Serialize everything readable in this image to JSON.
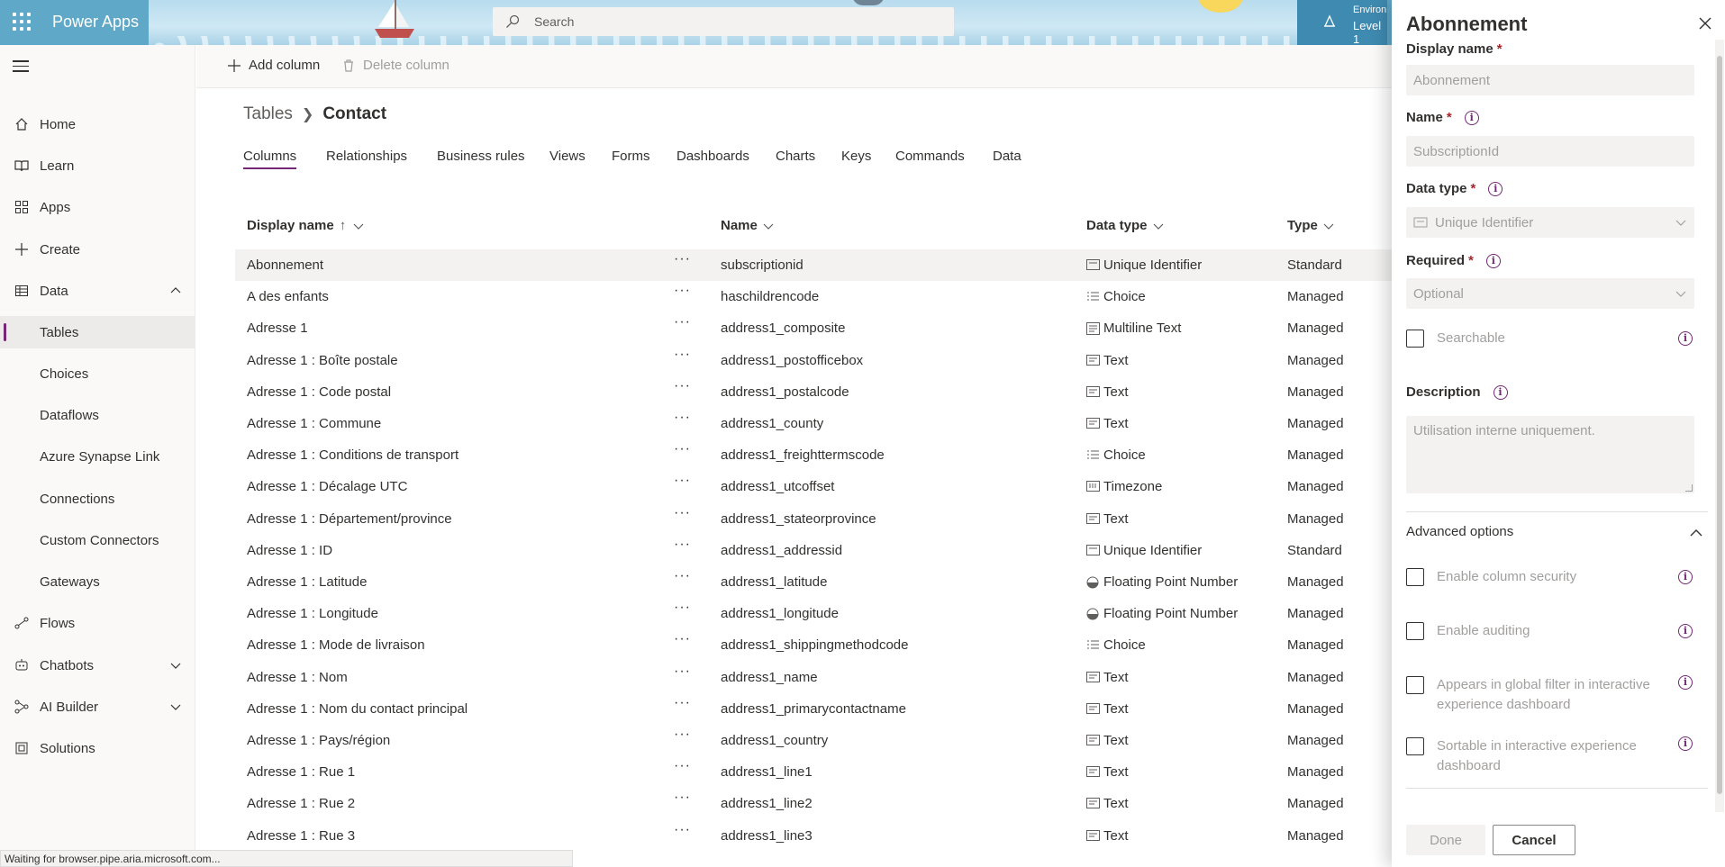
{
  "header": {
    "app_name": "Power Apps",
    "search_placeholder": "Search",
    "environment_label": "Environ",
    "environment_value": "Level 1"
  },
  "nav": {
    "items": [
      {
        "label": "Home",
        "icon": "home-icon"
      },
      {
        "label": "Learn",
        "icon": "book-icon"
      },
      {
        "label": "Apps",
        "icon": "apps-icon"
      },
      {
        "label": "Create",
        "icon": "plus-icon"
      },
      {
        "label": "Data",
        "icon": "table-icon"
      },
      {
        "label": "Tables"
      },
      {
        "label": "Choices"
      },
      {
        "label": "Dataflows"
      },
      {
        "label": "Azure Synapse Link"
      },
      {
        "label": "Connections"
      },
      {
        "label": "Custom Connectors"
      },
      {
        "label": "Gateways"
      },
      {
        "label": "Flows",
        "icon": "flow-icon"
      },
      {
        "label": "Chatbots",
        "icon": "bot-icon"
      },
      {
        "label": "AI Builder",
        "icon": "ai-icon"
      },
      {
        "label": "Solutions",
        "icon": "solutions-icon"
      }
    ]
  },
  "commands": {
    "add_column": "Add column",
    "delete_column": "Delete column"
  },
  "breadcrumb": {
    "root": "Tables",
    "current": "Contact"
  },
  "tabs": [
    "Columns",
    "Relationships",
    "Business rules",
    "Views",
    "Forms",
    "Dashboards",
    "Charts",
    "Keys",
    "Commands",
    "Data"
  ],
  "table": {
    "headers": {
      "display_name": "Display name",
      "name": "Name",
      "data_type": "Data type",
      "type": "Type"
    },
    "rows": [
      {
        "display": "Abonnement",
        "name": "subscriptionid",
        "dtype": "Unique Identifier",
        "type": "Standard",
        "icon": "id"
      },
      {
        "display": "A des enfants",
        "name": "haschildrencode",
        "dtype": "Choice",
        "type": "Managed",
        "icon": "choice"
      },
      {
        "display": "Adresse 1",
        "name": "address1_composite",
        "dtype": "Multiline Text",
        "type": "Managed",
        "icon": "multiline"
      },
      {
        "display": "Adresse 1 : Boîte postale",
        "name": "address1_postofficebox",
        "dtype": "Text",
        "type": "Managed",
        "icon": "text"
      },
      {
        "display": "Adresse 1 : Code postal",
        "name": "address1_postalcode",
        "dtype": "Text",
        "type": "Managed",
        "icon": "text"
      },
      {
        "display": "Adresse 1 : Commune",
        "name": "address1_county",
        "dtype": "Text",
        "type": "Managed",
        "icon": "text"
      },
      {
        "display": "Adresse 1 : Conditions de transport",
        "name": "address1_freighttermscode",
        "dtype": "Choice",
        "type": "Managed",
        "icon": "choice"
      },
      {
        "display": "Adresse 1 : Décalage UTC",
        "name": "address1_utcoffset",
        "dtype": "Timezone",
        "type": "Managed",
        "icon": "timezone"
      },
      {
        "display": "Adresse 1 : Département/province",
        "name": "address1_stateorprovince",
        "dtype": "Text",
        "type": "Managed",
        "icon": "text"
      },
      {
        "display": "Adresse 1 : ID",
        "name": "address1_addressid",
        "dtype": "Unique Identifier",
        "type": "Standard",
        "icon": "id"
      },
      {
        "display": "Adresse 1 : Latitude",
        "name": "address1_latitude",
        "dtype": "Floating Point Number",
        "type": "Managed",
        "icon": "float"
      },
      {
        "display": "Adresse 1 : Longitude",
        "name": "address1_longitude",
        "dtype": "Floating Point Number",
        "type": "Managed",
        "icon": "float"
      },
      {
        "display": "Adresse 1 : Mode de livraison",
        "name": "address1_shippingmethodcode",
        "dtype": "Choice",
        "type": "Managed",
        "icon": "choice"
      },
      {
        "display": "Adresse 1 : Nom",
        "name": "address1_name",
        "dtype": "Text",
        "type": "Managed",
        "icon": "text"
      },
      {
        "display": "Adresse 1 : Nom du contact principal",
        "name": "address1_primarycontactname",
        "dtype": "Text",
        "type": "Managed",
        "icon": "text"
      },
      {
        "display": "Adresse 1 : Pays/région",
        "name": "address1_country",
        "dtype": "Text",
        "type": "Managed",
        "icon": "text"
      },
      {
        "display": "Adresse 1 : Rue 1",
        "name": "address1_line1",
        "dtype": "Text",
        "type": "Managed",
        "icon": "text"
      },
      {
        "display": "Adresse 1 : Rue 2",
        "name": "address1_line2",
        "dtype": "Text",
        "type": "Managed",
        "icon": "text"
      },
      {
        "display": "Adresse 1 : Rue 3",
        "name": "address1_line3",
        "dtype": "Text",
        "type": "Managed",
        "icon": "text"
      }
    ]
  },
  "panel": {
    "title": "Abonnement",
    "display_name_label": "Display name",
    "display_name_value": "Abonnement",
    "name_label": "Name",
    "name_value": "SubscriptionId",
    "data_type_label": "Data type",
    "data_type_value": "Unique Identifier",
    "required_label": "Required",
    "required_value": "Optional",
    "searchable_label": "Searchable",
    "description_label": "Description",
    "description_placeholder": "Utilisation interne uniquement.",
    "advanced_label": "Advanced options",
    "options": [
      "Enable column security",
      "Enable auditing",
      "Appears in global filter in interactive experience dashboard",
      "Sortable in interactive experience dashboard"
    ],
    "done_label": "Done",
    "cancel_label": "Cancel",
    "required_marker": "*",
    "info_glyph": "i"
  },
  "status_text": "Waiting for browser.pipe.aria.microsoft.com...",
  "colors": {
    "accent": "#742774",
    "header": "#5fa8c7"
  }
}
